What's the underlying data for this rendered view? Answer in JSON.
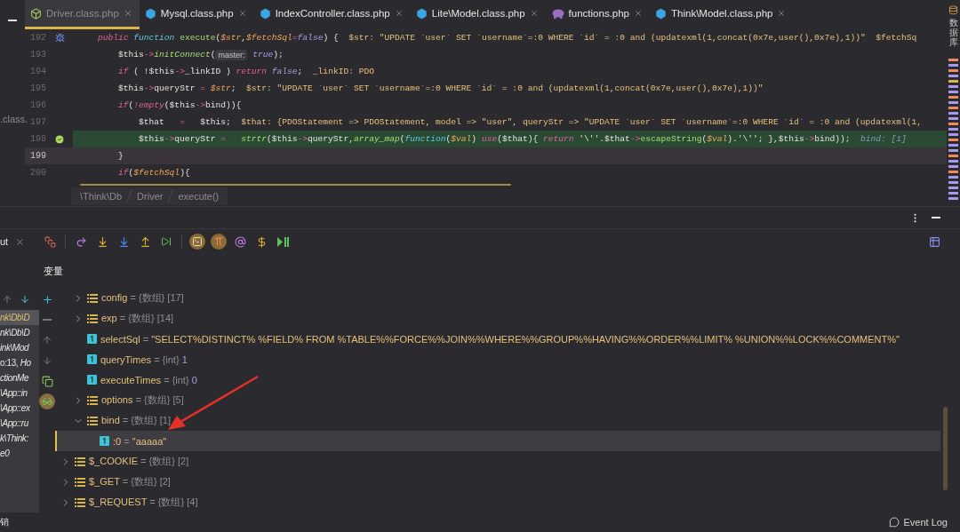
{
  "project_panel": {
    "fragment": ".class."
  },
  "tabs": [
    {
      "label": "Driver.class.php",
      "kind": "class",
      "selected": true
    },
    {
      "label": "Mysql.class.php",
      "kind": "class",
      "selected": false
    },
    {
      "label": "IndexController.class.php",
      "kind": "class",
      "selected": false
    },
    {
      "label": "Lite\\Model.class.php",
      "kind": "class",
      "selected": false
    },
    {
      "label": "functions.php",
      "kind": "php",
      "selected": false
    },
    {
      "label": "Think\\Model.class.php",
      "kind": "class",
      "selected": false
    }
  ],
  "editor": {
    "lines": [
      {
        "number": "192",
        "kind": "normal",
        "gutter_icon": {
          "kind": "debug"
        },
        "tokens": [
          {
            "kind": "kw",
            "text": "public "
          },
          {
            "kind": "fk",
            "text": "function "
          },
          {
            "kind": "def",
            "text": "execute"
          },
          {
            "kind": "p",
            "text": "("
          },
          {
            "kind": "var",
            "text": "$str"
          },
          {
            "kind": "p",
            "text": ","
          },
          {
            "kind": "var",
            "text": "$fetchSql"
          },
          {
            "kind": "op",
            "text": "="
          },
          {
            "kind": "bool",
            "text": "false"
          },
          {
            "kind": "p",
            "text": ") {  "
          },
          {
            "kind": "hint",
            "text": "$str: \"UPDATE `user` SET `username`=:0 WHERE `id` = :0 and (updatexml(1,concat(0x7e,user(),0x7e),1))\"  $fetchSq"
          }
        ]
      },
      {
        "number": "193",
        "kind": "normal",
        "tokens": [
          {
            "kind": "p",
            "text": "    $this"
          },
          {
            "kind": "op",
            "text": "->"
          },
          {
            "kind": "call",
            "text": "initConnect"
          },
          {
            "kind": "p",
            "text": "("
          },
          {
            "kind": "inlay",
            "text": "master:"
          },
          {
            "kind": "bool",
            "text": " true"
          },
          {
            "kind": "p",
            "text": ");"
          }
        ]
      },
      {
        "number": "194",
        "kind": "normal",
        "tokens": [
          {
            "kind": "kw",
            "text": "    if"
          },
          {
            "kind": "p",
            "text": " ( !$this"
          },
          {
            "kind": "op",
            "text": "->"
          },
          {
            "kind": "p",
            "text": "_linkID ) "
          },
          {
            "kind": "kw",
            "text": "return "
          },
          {
            "kind": "bool",
            "text": "false"
          },
          {
            "kind": "p",
            "text": ";  "
          },
          {
            "kind": "hint",
            "text": "_linkID: PDO"
          }
        ]
      },
      {
        "number": "195",
        "kind": "normal",
        "tokens": [
          {
            "kind": "p",
            "text": "    $this"
          },
          {
            "kind": "op",
            "text": "->"
          },
          {
            "kind": "p",
            "text": "queryStr "
          },
          {
            "kind": "op",
            "text": "= "
          },
          {
            "kind": "var",
            "text": "$str"
          },
          {
            "kind": "p",
            "text": ";  "
          },
          {
            "kind": "hint",
            "text": "$str: \"UPDATE `user` SET `username`=:0 WHERE `id` = :0 and (updatexml(1,concat(0x7e,user(),0x7e),1))\""
          }
        ]
      },
      {
        "number": "196",
        "kind": "normal",
        "tokens": [
          {
            "kind": "kw",
            "text": "    if"
          },
          {
            "kind": "p",
            "text": "("
          },
          {
            "kind": "kw",
            "text": "!empty"
          },
          {
            "kind": "p",
            "text": "($this"
          },
          {
            "kind": "op",
            "text": "->"
          },
          {
            "kind": "p",
            "text": "bind)){"
          }
        ]
      },
      {
        "number": "197",
        "kind": "normal",
        "tokens": [
          {
            "kind": "p",
            "text": "        $that   "
          },
          {
            "kind": "op",
            "text": "="
          },
          {
            "kind": "p",
            "text": "   $this;  "
          },
          {
            "kind": "hint",
            "text": "$that: {PDOStatement => PDOStatement, model => \"user\", queryStr => \"UPDATE `user` SET `username`=:0 WHERE `id` = :0 and (updatexml(1,"
          }
        ]
      },
      {
        "number": "198",
        "kind": "breakpoint",
        "gutter_icon": {
          "kind": "check"
        },
        "tokens": [
          {
            "kind": "p",
            "text": "        $this"
          },
          {
            "kind": "op",
            "text": "->"
          },
          {
            "kind": "p",
            "text": "queryStr "
          },
          {
            "kind": "op",
            "text": "="
          },
          {
            "kind": "call",
            "text": "   strtr"
          },
          {
            "kind": "p",
            "text": "($this"
          },
          {
            "kind": "op",
            "text": "->"
          },
          {
            "kind": "p",
            "text": "queryStr,"
          },
          {
            "kind": "call",
            "text": "array_map"
          },
          {
            "kind": "p",
            "text": "("
          },
          {
            "kind": "fk",
            "text": "function"
          },
          {
            "kind": "p",
            "text": "("
          },
          {
            "kind": "var",
            "text": "$val"
          },
          {
            "kind": "p",
            "text": ") "
          },
          {
            "kind": "kw",
            "text": "use"
          },
          {
            "kind": "p",
            "text": "($that){ "
          },
          {
            "kind": "kw",
            "text": "return "
          },
          {
            "kind": "str",
            "text": "'\\''"
          },
          {
            "kind": "p",
            "text": ".$that"
          },
          {
            "kind": "op",
            "text": "->"
          },
          {
            "kind": "def",
            "text": "escapeString"
          },
          {
            "kind": "p",
            "text": "("
          },
          {
            "kind": "var",
            "text": "$val"
          },
          {
            "kind": "p",
            "text": ")."
          },
          {
            "kind": "str",
            "text": "'\\''"
          },
          {
            "kind": "p",
            "text": "; },$this"
          },
          {
            "kind": "op",
            "text": "->"
          },
          {
            "kind": "p",
            "text": "bind));  "
          },
          {
            "kind": "ihint",
            "text": "bind: [1]"
          }
        ]
      },
      {
        "number": "199",
        "kind": "current",
        "tokens": [
          {
            "kind": "p",
            "text": "    }"
          }
        ]
      },
      {
        "number": "200",
        "kind": "normal",
        "tokens": [
          {
            "kind": "kw",
            "text": "    if"
          },
          {
            "kind": "p",
            "text": "("
          },
          {
            "kind": "var",
            "text": "$fetchSql"
          },
          {
            "kind": "p",
            "text": "){"
          }
        ]
      }
    ]
  },
  "breadcrumbs": [
    "\\Think\\Db",
    "Driver",
    "execute()"
  ],
  "side_stripe": {
    "label": "数据库"
  },
  "debugger": {
    "session_tab": "ut",
    "panel_title": "变量",
    "frames": [
      {
        "label": "nk\\Db\\D",
        "italic": true,
        "selected": true
      },
      {
        "label": "nk\\Db\\D",
        "italic": true,
        "selected": false
      },
      {
        "label": "ink\\Mod",
        "italic": true,
        "selected": false
      },
      {
        "label": "o:13, *Ho*",
        "italic": false,
        "selected": false
      },
      {
        "label": "ctionMe",
        "italic": true,
        "selected": false
      },
      {
        "label": "\\App::in",
        "italic": true,
        "selected": false
      },
      {
        "label": "\\App::ex",
        "italic": true,
        "selected": false
      },
      {
        "label": "\\App::ru",
        "italic": true,
        "selected": false
      },
      {
        "label": "k\\Think:",
        "italic": true,
        "selected": false
      },
      {
        "label": "e0",
        "italic": true,
        "selected": false
      }
    ],
    "members": [
      {
        "name": "config",
        "op": "=",
        "type": "{数组}",
        "value": "[17]",
        "kind": "array",
        "expanded": false,
        "selected": false
      },
      {
        "name": "exp",
        "op": "=",
        "type": "{数组}",
        "value": "[14]",
        "kind": "array",
        "expanded": false,
        "selected": false
      },
      {
        "name": "selectSql",
        "op": "=",
        "value": "\"SELECT%DISTINCT% %FIELD% FROM %TABLE%%FORCE%%JOIN%%WHERE%%GROUP%%HAVING%%ORDER%%LIMIT% %UNION%%LOCK%%COMMENT%\"",
        "kind": "string",
        "selected": false
      },
      {
        "name": "queryTimes",
        "op": "=",
        "type": "{int}",
        "value": "1",
        "kind": "int",
        "selected": false
      },
      {
        "name": "executeTimes",
        "op": "=",
        "type": "{int}",
        "value": "0",
        "kind": "int",
        "selected": false
      },
      {
        "name": "options",
        "op": "=",
        "type": "{数组}",
        "value": "[5]",
        "kind": "array",
        "expanded": false,
        "selected": false
      },
      {
        "name": "bind",
        "op": "=",
        "type": "{数组}",
        "value": "[1]",
        "kind": "array",
        "expanded": true,
        "selected": false,
        "children": [
          {
            "name": ":0",
            "op": "=",
            "value": "\"aaaaa\"",
            "kind": "string",
            "selected": true
          }
        ]
      }
    ],
    "globals": [
      {
        "name": "$_COOKIE",
        "op": "=",
        "type": "{数组}",
        "value": "[2]",
        "kind": "array",
        "expanded": false,
        "selected": false
      },
      {
        "name": "$_GET",
        "op": "=",
        "type": "{数组}",
        "value": "[2]",
        "kind": "array",
        "expanded": false,
        "selected": false
      },
      {
        "name": "$_REQUEST",
        "op": "=",
        "type": "{数组}",
        "value": "[4]",
        "kind": "array",
        "expanded": false,
        "selected": false
      }
    ]
  },
  "status_bar": {
    "left": "销",
    "event_log": "Event Log"
  }
}
